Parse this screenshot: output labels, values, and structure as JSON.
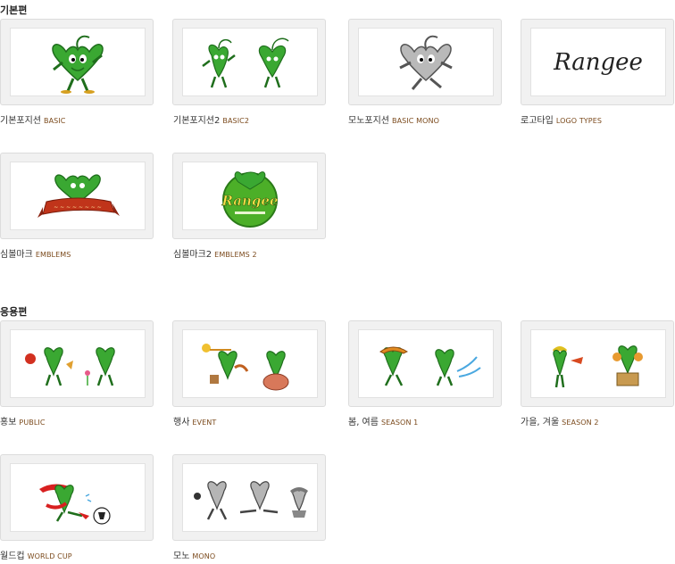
{
  "sections": [
    {
      "title": "기본편",
      "items": [
        {
          "ko": "기본포지션",
          "en": "BASIC"
        },
        {
          "ko": "기본포지션2",
          "en": "BASIC2"
        },
        {
          "ko": "모노포지션",
          "en": "BASIC MONO"
        },
        {
          "ko": "로고타입",
          "en": "LOGO TYPES"
        },
        {
          "ko": "심볼마크",
          "en": "EMBLEMS"
        },
        {
          "ko": "심볼마크2",
          "en": "EMBLEMS 2"
        }
      ]
    },
    {
      "title": "응용편",
      "items": [
        {
          "ko": "홍보",
          "en": "PUBLIC"
        },
        {
          "ko": "행사",
          "en": "EVENT"
        },
        {
          "ko": "봄, 여름",
          "en": "SEASON 1"
        },
        {
          "ko": "가을, 겨울",
          "en": "SEASON 2"
        },
        {
          "ko": "월드컵",
          "en": "WORLD CUP"
        },
        {
          "ko": "모노",
          "en": "MONO"
        }
      ]
    }
  ],
  "logo_text": "Rangee",
  "colors": {
    "mascot_green": "#2f9e2a",
    "mascot_dark": "#1f6e1c",
    "mono_gray": "#9a9a9a",
    "emblem_red": "#c0341a",
    "caption_en": "#7b4a1c"
  }
}
